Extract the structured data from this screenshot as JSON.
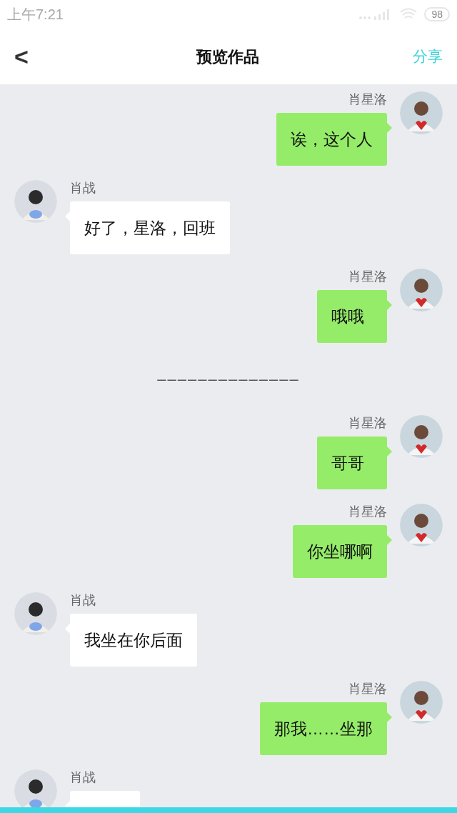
{
  "status_bar": {
    "time": "上午7:21",
    "battery": "98"
  },
  "nav": {
    "back": "<",
    "title": "预览作品",
    "action": "分享"
  },
  "messages": [
    {
      "kind": "sent",
      "name": "肖星洛",
      "text": "诶，这个人"
    },
    {
      "kind": "received",
      "name": "肖战",
      "text": "好了，星洛，回班"
    },
    {
      "kind": "sent",
      "name": "肖星洛",
      "text": "哦哦"
    },
    {
      "kind": "divider",
      "text": "––––––––––––––"
    },
    {
      "kind": "sent",
      "name": "肖星洛",
      "text": "哥哥"
    },
    {
      "kind": "sent",
      "name": "肖星洛",
      "text": "你坐哪啊"
    },
    {
      "kind": "received",
      "name": "肖战",
      "text": "我坐在你后面"
    },
    {
      "kind": "sent",
      "name": "肖星洛",
      "text": "那我……坐那"
    },
    {
      "kind": "received",
      "name": "肖战"
    }
  ]
}
